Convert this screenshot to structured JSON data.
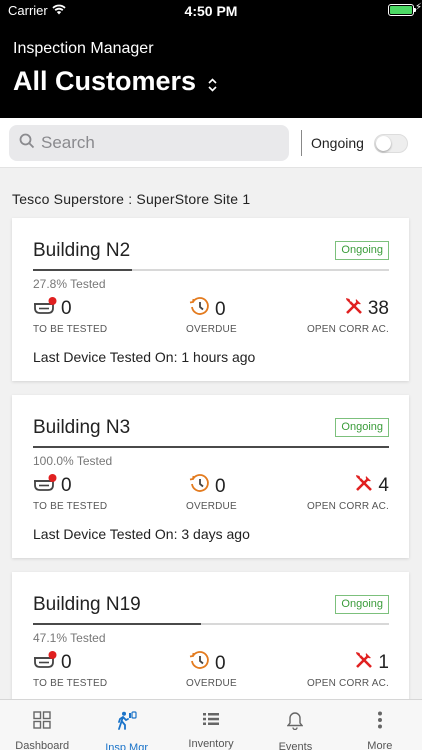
{
  "status_bar": {
    "carrier": "Carrier",
    "time": "4:50 PM"
  },
  "header": {
    "app_title": "Inspection Manager",
    "customer": "All Customers"
  },
  "search": {
    "placeholder": "Search"
  },
  "filter": {
    "label": "Ongoing",
    "on": false
  },
  "site": {
    "label": "Tesco Superstore  : SuperStore Site 1"
  },
  "colors": {
    "accent": "#1a73c9",
    "badge_green": "#3a9c3a",
    "alert_red": "#e02020",
    "overdue_orange": "#e37b1f"
  },
  "stat_labels": {
    "to_be_tested": "TO BE TESTED",
    "overdue": "OVERDUE",
    "open_corr": "OPEN CORR AC."
  },
  "buildings": [
    {
      "name": "Building N2",
      "status": "Ongoing",
      "progress": 0.278,
      "tested": "27.8% Tested",
      "to_be_tested": "0",
      "overdue": "0",
      "open_corr": "38",
      "last_tested": "Last Device Tested On: 1 hours ago"
    },
    {
      "name": "Building N3",
      "status": "Ongoing",
      "progress": 1.0,
      "tested": "100.0% Tested",
      "to_be_tested": "0",
      "overdue": "0",
      "open_corr": "4",
      "last_tested": "Last Device Tested On: 3 days ago"
    },
    {
      "name": "Building N19",
      "status": "Ongoing",
      "progress": 0.471,
      "tested": "47.1% Tested",
      "to_be_tested": "0",
      "overdue": "0",
      "open_corr": "1",
      "last_tested": ""
    }
  ],
  "tabs": [
    {
      "label": "Dashboard",
      "icon": "dashboard-grid-icon",
      "active": false
    },
    {
      "label": "Insp Mgr",
      "icon": "inspector-walking-icon",
      "active": true
    },
    {
      "label": "Inventory",
      "icon": "inventory-list-icon",
      "active": false
    },
    {
      "label": "Events",
      "icon": "bell-icon",
      "active": false
    },
    {
      "label": "More",
      "icon": "more-dots-icon",
      "active": false
    }
  ]
}
